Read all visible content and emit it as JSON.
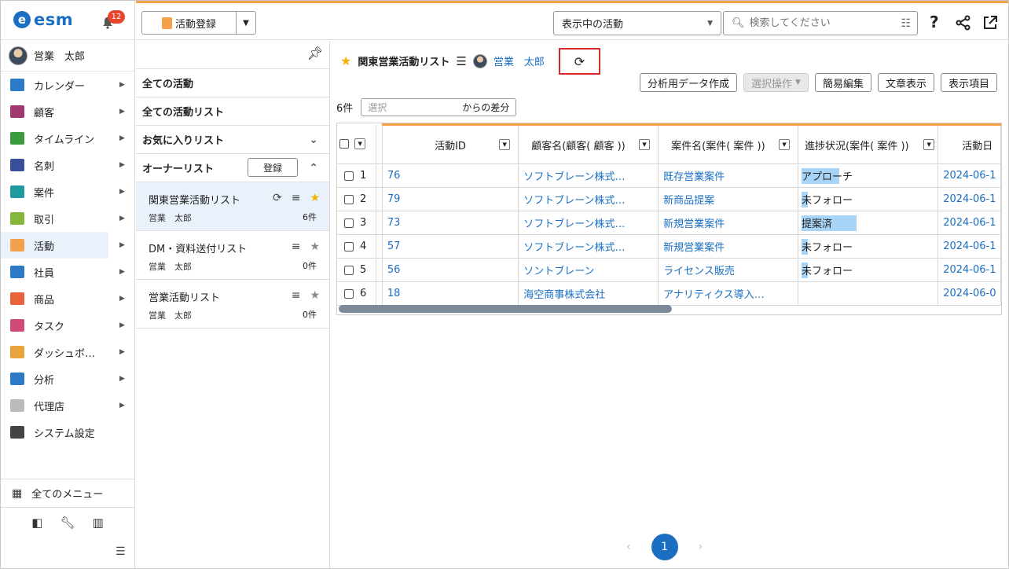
{
  "app": {
    "logo_text": "esm",
    "notification_count": "12",
    "user_name": "営業　太郎"
  },
  "sidebar": {
    "items": [
      {
        "label": "カレンダー",
        "icon": "calendar-icon",
        "color": "#2d7ac9",
        "active": false
      },
      {
        "label": "顧客",
        "icon": "building-icon",
        "color": "#a03a6e",
        "active": false
      },
      {
        "label": "タイムライン",
        "icon": "chat-icon",
        "color": "#3b9a3b",
        "active": false
      },
      {
        "label": "名刺",
        "icon": "card-icon",
        "color": "#3a4f9c",
        "active": false
      },
      {
        "label": "案件",
        "icon": "folder-icon",
        "color": "#1f9aa0",
        "active": false
      },
      {
        "label": "取引",
        "icon": "deal-icon",
        "color": "#84b73a",
        "active": false
      },
      {
        "label": "活動",
        "icon": "clipboard-icon",
        "color": "#f5a04a",
        "active": true
      },
      {
        "label": "社員",
        "icon": "person-icon",
        "color": "#2d7ac9",
        "active": false
      },
      {
        "label": "商品",
        "icon": "box-icon",
        "color": "#e8623a",
        "active": false
      },
      {
        "label": "タスク",
        "icon": "check-icon",
        "color": "#d04a7a",
        "active": false
      },
      {
        "label": "ダッシュボ…",
        "icon": "dashboard-icon",
        "color": "#e8a33a",
        "active": false
      },
      {
        "label": "分析",
        "icon": "chart-icon",
        "color": "#2d7ac9",
        "active": false
      },
      {
        "label": "代理店",
        "icon": "document-icon",
        "color": "#bbbbbb",
        "active": false
      },
      {
        "label": "システム設定",
        "icon": "gear-icon",
        "color": "#444444",
        "active": false
      }
    ],
    "all_menu_label": "全てのメニュー"
  },
  "topbar": {
    "register_label": "活動登録",
    "view_select": "表示中の活動",
    "search_placeholder": "検索してください"
  },
  "listpanel": {
    "sections": {
      "all_activities": "全ての活動",
      "all_lists": "全ての活動リスト",
      "favorites": "お気に入りリスト",
      "owner_lists": "オーナーリスト",
      "register_button": "登録"
    },
    "lists": [
      {
        "name": "関東営業活動リスト",
        "owner": "営業　太郎",
        "count": "6件",
        "favorite": true,
        "selected": true
      },
      {
        "name": "DM・資料送付リスト",
        "owner": "営業　太郎",
        "count": "0件",
        "favorite": false,
        "selected": false
      },
      {
        "name": "営業活動リスト",
        "owner": "営業　太郎",
        "count": "0件",
        "favorite": false,
        "selected": false
      }
    ]
  },
  "main": {
    "list_title": "関東営業活動リスト",
    "owner_name": "営業　太郎",
    "actions": {
      "analysis_data": "分析用データ作成",
      "select_ops": "選択操作",
      "quick_edit": "簡易編集",
      "text_view": "文章表示",
      "display_items": "表示項目"
    },
    "count": "6件",
    "diff_placeholder": "選択",
    "diff_suffix": "からの差分",
    "table": {
      "headers": [
        "活動ID",
        "顧客名(顧客( 顧客 ))",
        "案件名(案件( 案件 ))",
        "進捗状況(案件( 案件 ))",
        "活動日"
      ],
      "rows": [
        {
          "num": "1",
          "id": "76",
          "customer": "ソフトブレーン株式…",
          "deal": "既存営業案件",
          "status": "アプローチ",
          "date": "2024-06-1"
        },
        {
          "num": "2",
          "id": "79",
          "customer": "ソフトブレーン株式…",
          "deal": "新商品提案",
          "status": "未フォロー",
          "date": "2024-06-1"
        },
        {
          "num": "3",
          "id": "73",
          "customer": "ソフトブレーン株式…",
          "deal": "新規営業案件",
          "status": "提案済",
          "date": "2024-06-1"
        },
        {
          "num": "4",
          "id": "57",
          "customer": "ソフトブレーン株式…",
          "deal": "新規営業案件",
          "status": "未フォロー",
          "date": "2024-06-1"
        },
        {
          "num": "5",
          "id": "56",
          "customer": "ソントブレーン",
          "deal": "ライセンス販売",
          "status": "未フォロー",
          "date": "2024-06-1"
        },
        {
          "num": "6",
          "id": "18",
          "customer": "海空商事株式会社",
          "deal": "アナリティクス導入…",
          "status": "",
          "date": "2024-06-0"
        }
      ]
    },
    "pagination": {
      "current": "1"
    }
  }
}
